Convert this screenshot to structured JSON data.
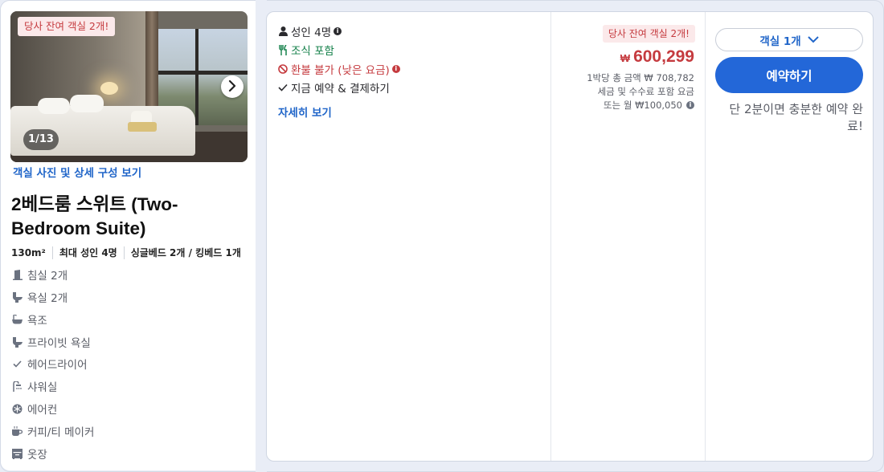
{
  "room": {
    "photo_badge": "당사 잔여 객실 2개!",
    "photo_counter": "1/13",
    "photos_link": "객실 사진 및 상세 구성 보기",
    "title": "2베드룸 스위트 (Two-Bedroom Suite)",
    "facts": [
      "130m²",
      "최대 성인 4명",
      "싱글베드 2개 / 킹베드 1개"
    ],
    "amenities": [
      {
        "label": "침실 2개",
        "icon": "door-icon"
      },
      {
        "label": "욕실 2개",
        "icon": "toilet-icon"
      },
      {
        "label": "욕조",
        "icon": "bathtub-icon"
      },
      {
        "label": "프라이빗 욕실",
        "icon": "toilet-icon"
      },
      {
        "label": "헤어드라이어",
        "icon": "check-icon"
      },
      {
        "label": "샤워실",
        "icon": "shower-icon"
      },
      {
        "label": "에어컨",
        "icon": "snowflake-icon"
      },
      {
        "label": "커피/티 메이커",
        "icon": "coffee-icon"
      },
      {
        "label": "옷장",
        "icon": "wardrobe-icon"
      }
    ]
  },
  "offer": {
    "guests": "성인 4명",
    "breakfast": "조식 포함",
    "refund": "환불 불가 (낮은 요금)",
    "pay_now": "지금 예약 & 결제하기",
    "details_link": "자세히 보기"
  },
  "price": {
    "badge": "당사 잔여 객실 2개!",
    "currency": "₩",
    "amount": "600,299",
    "per_night_total": "1박당 총 금액 ₩ 708,782",
    "incl_fees": "세금 및 수수료 포함 요금",
    "monthly": "또는 월 ₩100,050"
  },
  "booking": {
    "room_select": "객실 1개",
    "book_button": "예약하기",
    "quick_note": "단 2분이면 충분한 예약 완료!"
  },
  "colors": {
    "accent": "#2367d8",
    "link": "#2166c9",
    "price_red": "#c53b3f",
    "green": "#14804a",
    "badge_bg": "#fbe9ea"
  }
}
